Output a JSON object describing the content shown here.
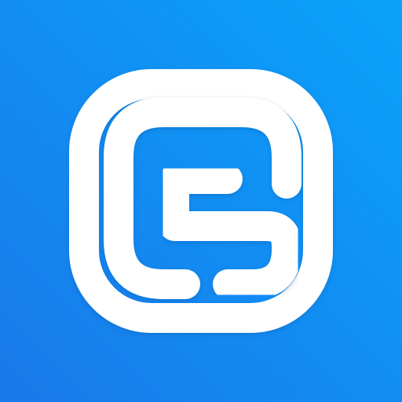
{
  "icon": {
    "name": "app-logo-icon",
    "background_gradient": [
      "#0AA2FB",
      "#1979EA"
    ],
    "foreground_color": "#FFFFFF"
  }
}
